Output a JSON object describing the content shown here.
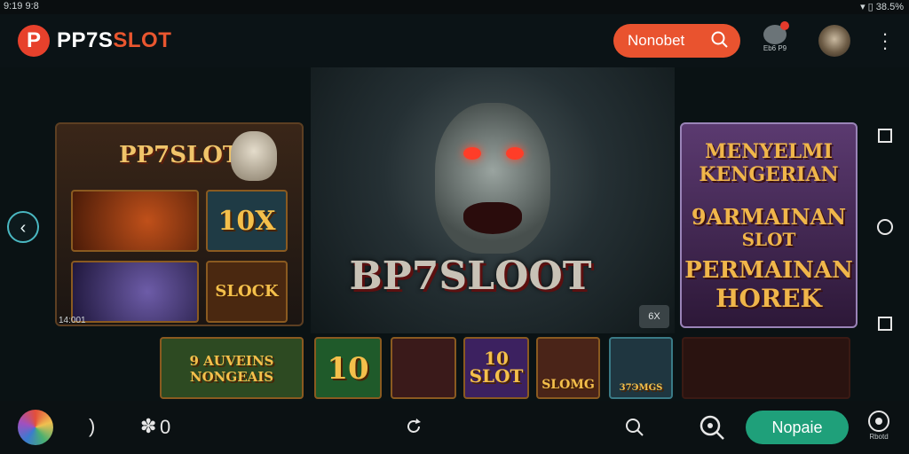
{
  "status": {
    "left": "9:19 9:8",
    "right": "38.5%"
  },
  "topbar": {
    "logo_letter": "P",
    "logo_main": "PP7S",
    "logo_accent": "SLOT",
    "search_label": "Nonobet",
    "notif_label": "Eb6 P9"
  },
  "stage": {
    "left_panel": {
      "title": "PP7SLOT",
      "tile_2": "10X",
      "tile_4": "SLOCK",
      "caption": "14:001"
    },
    "hero": {
      "title": "BP7SLOOT",
      "corner_btn": "6X"
    },
    "right_panel": {
      "line1": "MENYELMI",
      "line2": "KENGERIAN",
      "line3": "9ARMAINAN",
      "line4": "SLOT",
      "line5": "PERMAINAN",
      "line6": "HOREK"
    },
    "strip": [
      {
        "label": "9 AUVEINS NONGEAIS"
      },
      {
        "label": "10"
      },
      {
        "label": ""
      },
      {
        "label": "10 SLOT"
      },
      {
        "label": "SLOMG"
      },
      {
        "label": "37ЭMGS"
      },
      {
        "label": ""
      }
    ]
  },
  "bottombar": {
    "count": "0",
    "play_label": "Nopaie",
    "right_label": "Rbotd"
  }
}
